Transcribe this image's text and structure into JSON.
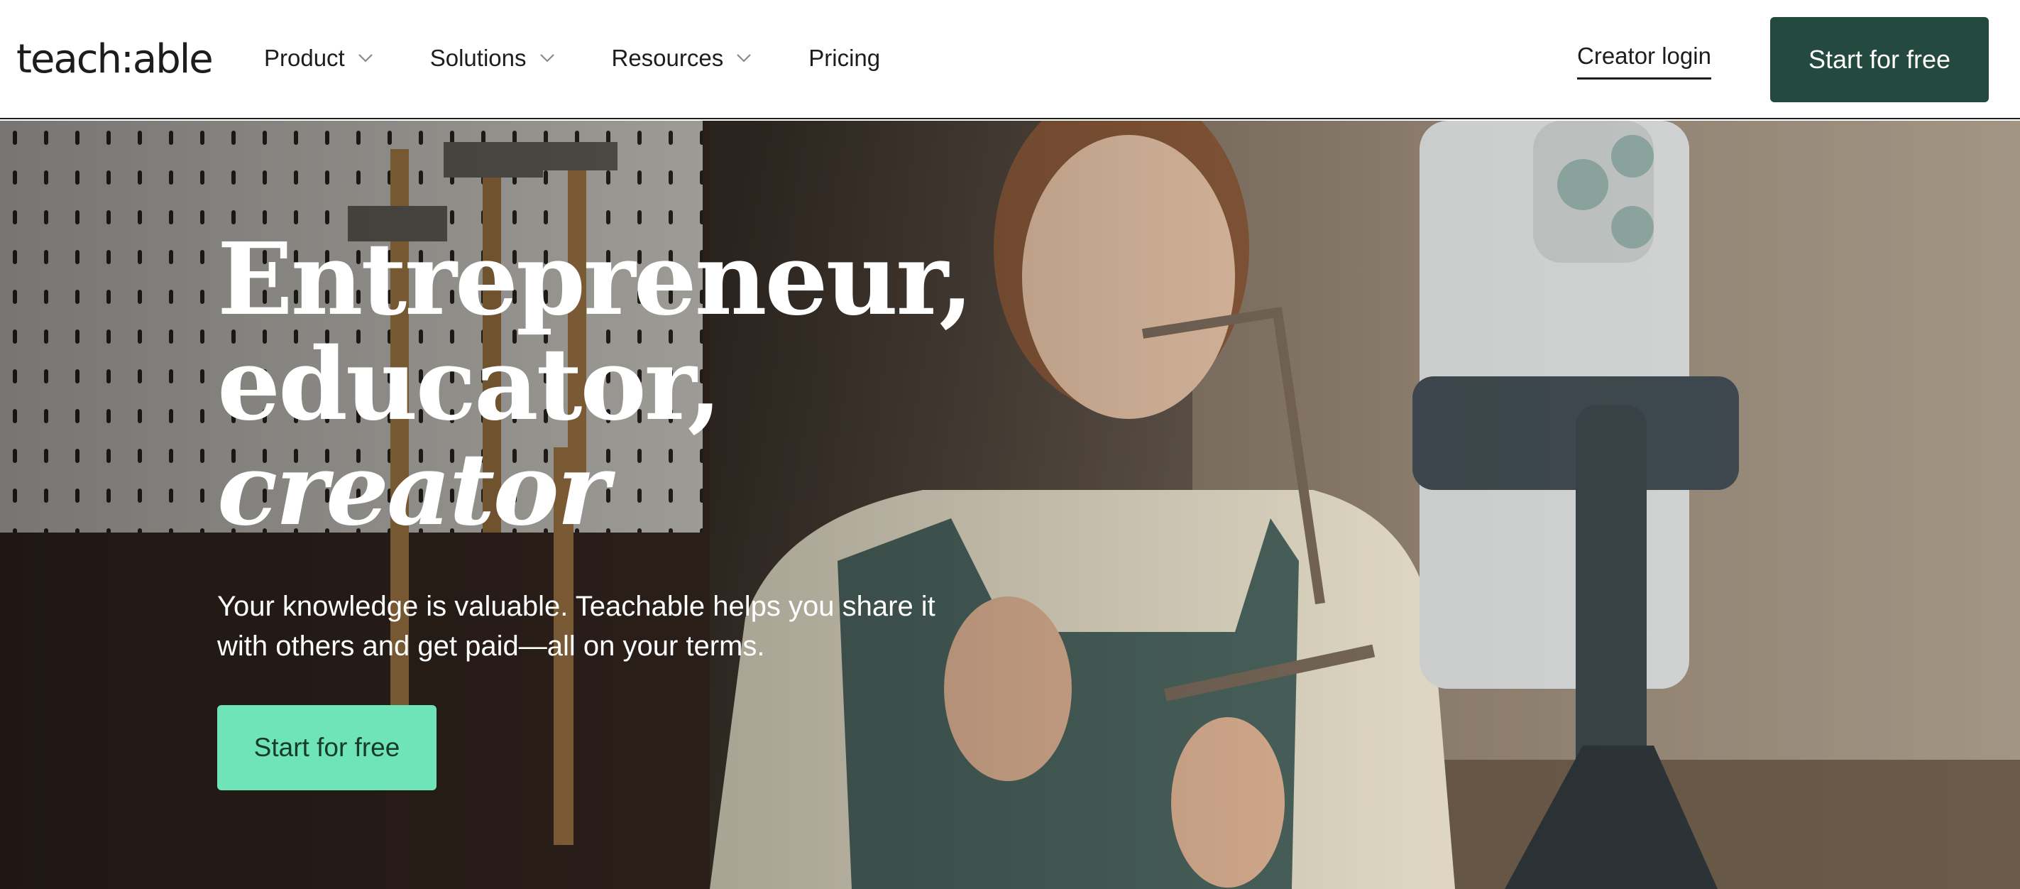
{
  "header": {
    "logo": "teach:able",
    "nav": [
      {
        "label": "Product",
        "has_dropdown": true
      },
      {
        "label": "Solutions",
        "has_dropdown": true
      },
      {
        "label": "Resources",
        "has_dropdown": true
      },
      {
        "label": "Pricing",
        "has_dropdown": false
      }
    ],
    "login_label": "Creator login",
    "cta_label": "Start for free",
    "cta_color": "#24493e"
  },
  "hero": {
    "headline_line1": "Entrepreneur,",
    "headline_line2": "educator,",
    "headline_line3": "creator",
    "subtext": "Your knowledge is valuable. Teachable helps you share it with others and get paid—all on your terms.",
    "cta_label": "Start for free",
    "cta_color": "#6fe4b9"
  },
  "icons": {
    "dropdown": "chevron-down-icon"
  }
}
